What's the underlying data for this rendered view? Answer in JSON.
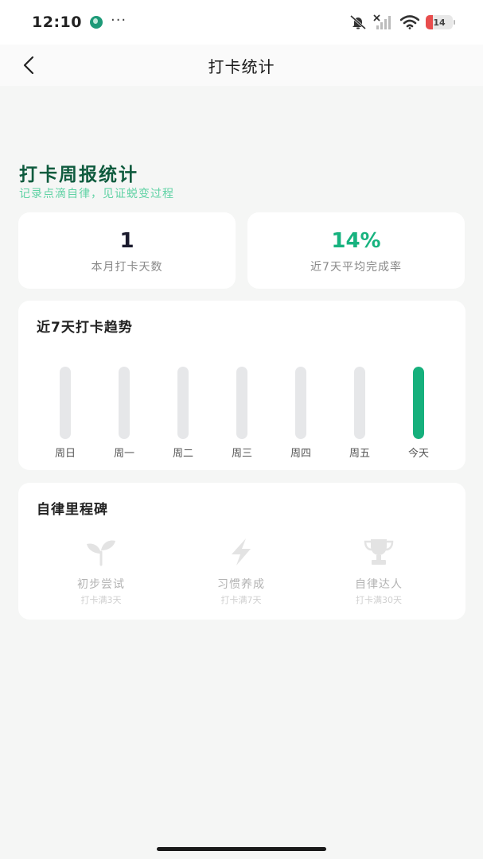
{
  "status_bar": {
    "time": "12:10",
    "battery_level": "14",
    "battery_color": "#e84d4d"
  },
  "header": {
    "title": "打卡统计",
    "back_icon": "chevron-left-icon"
  },
  "report": {
    "title": "打卡周报统计",
    "subtitle": "记录点滴自律，见证蜕变过程"
  },
  "stats": [
    {
      "value": "1",
      "label": "本月打卡天数"
    },
    {
      "value": "14%",
      "label": "近7天平均完成率"
    }
  ],
  "trend": {
    "title": "近7天打卡趋势",
    "accent_color": "#16b07c",
    "track_color": "#e6e7e9",
    "days": [
      {
        "label": "周日",
        "completion": 0
      },
      {
        "label": "周一",
        "completion": 0
      },
      {
        "label": "周二",
        "completion": 0
      },
      {
        "label": "周三",
        "completion": 0
      },
      {
        "label": "周四",
        "completion": 0
      },
      {
        "label": "周五",
        "completion": 0
      },
      {
        "label": "今天",
        "completion": 1
      }
    ]
  },
  "milestones": {
    "title": "自律里程碑",
    "items": [
      {
        "name": "初步尝试",
        "requirement": "打卡满3天",
        "icon": "sprout-icon"
      },
      {
        "name": "习惯养成",
        "requirement": "打卡满7天",
        "icon": "lightning-icon"
      },
      {
        "name": "自律达人",
        "requirement": "打卡满30天",
        "icon": "trophy-icon"
      }
    ]
  },
  "colors": {
    "title_green": "#0f5b3e",
    "subtitle_green": "#5fd2a4",
    "percent_green": "#17b37f",
    "background": "#f5f6f5"
  }
}
